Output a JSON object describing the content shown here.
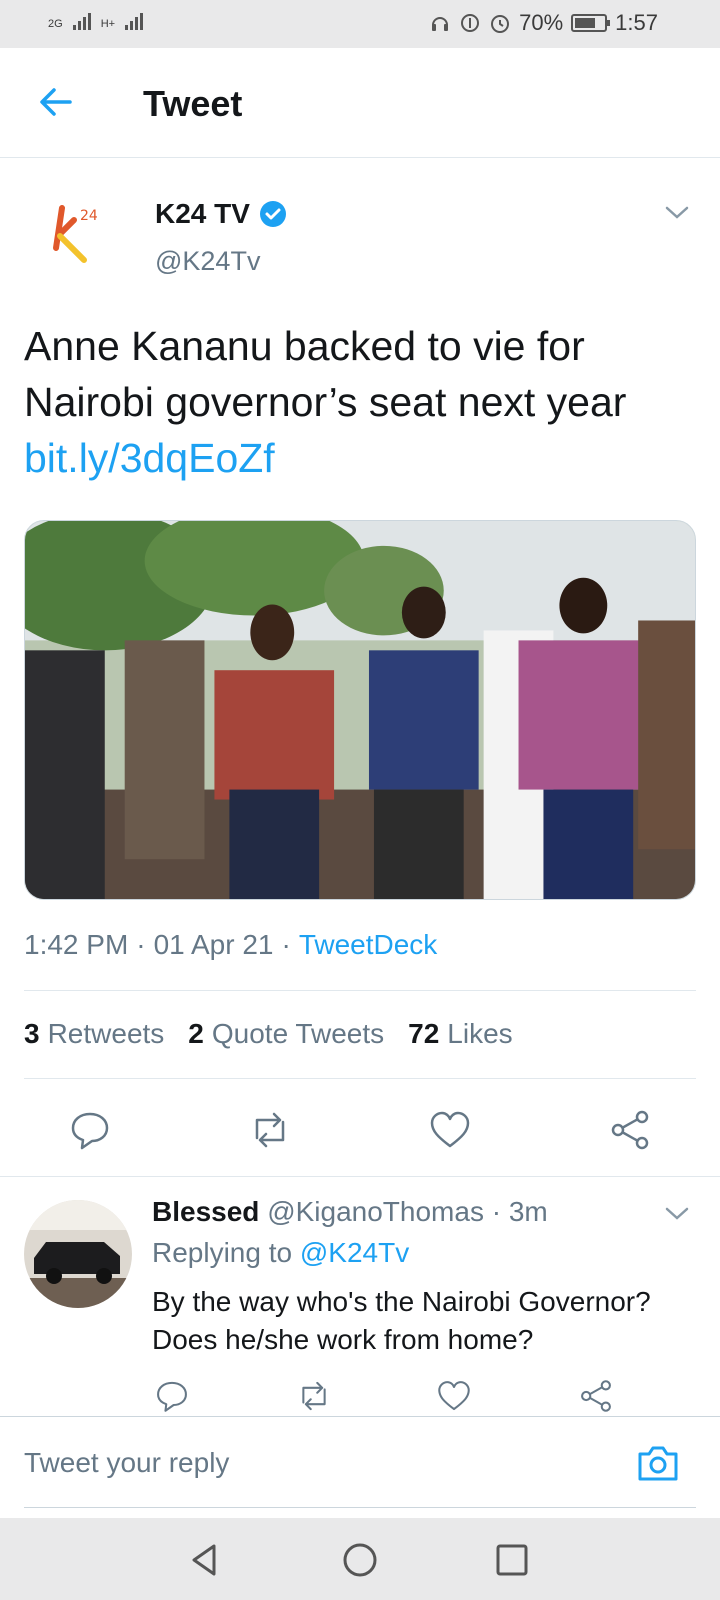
{
  "status_bar": {
    "net1": "2G",
    "net2": "H+",
    "battery": "70%",
    "battery_level": 0.7,
    "time": "1:57"
  },
  "header": {
    "title": "Tweet",
    "back_icon": "back-arrow-icon"
  },
  "tweet": {
    "author_name": "K24 TV",
    "author_handle": "@K24Tv",
    "avatar_text": "24",
    "text_line1": "Anne Kananu backed to vie for",
    "text_line2": "Nairobi governor’s seat next year",
    "link": "bit.ly/3dqEoZf",
    "time": "1:42 PM",
    "date": "01 Apr 21",
    "source": "TweetDeck",
    "sep": "·",
    "retweets_count": "3",
    "retweets_label": "Retweets",
    "quotes_count": "2",
    "quotes_label": "Quote Tweets",
    "likes_count": "72",
    "likes_label": "Likes"
  },
  "reply": {
    "name": "Blessed",
    "handle": "@KiganoThomas",
    "age": "· 3m",
    "replying_prefix": "Replying to",
    "replying_handle": "@K24Tv",
    "text": "By the way who's the Nairobi Governor? Does he/she work from home?"
  },
  "compose": {
    "placeholder": "Tweet your reply"
  },
  "colors": {
    "accent": "#1da1f2",
    "text": "#14171a",
    "muted": "#657786"
  }
}
